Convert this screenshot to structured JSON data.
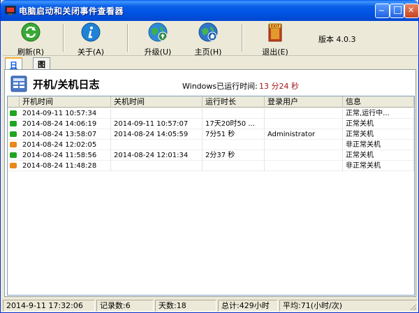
{
  "window": {
    "title": "电脑启动和关闭事件查看器",
    "minimize_glyph": "─",
    "maximize_glyph": "□",
    "close_glyph": "✕"
  },
  "toolbar": {
    "refresh": {
      "label": "刷新(R)",
      "icon": "refresh-icon",
      "color": "#3aa836"
    },
    "about": {
      "label": "关于(A)",
      "icon": "info-icon",
      "color": "#1f82d6"
    },
    "upgrade": {
      "label": "升级(U)",
      "icon": "globe-upgrade-icon",
      "color": "#2f8a44"
    },
    "home": {
      "label": "主页(H)",
      "icon": "globe-home-icon",
      "color": "#2e77c9"
    },
    "exit": {
      "label": "退出(E)",
      "icon": "exit-door-icon",
      "color": "#e0a22b"
    },
    "version": "版本 4.0.3"
  },
  "tabs": [
    {
      "label": "日志",
      "active": true
    },
    {
      "label": "图表",
      "active": false
    }
  ],
  "panel": {
    "title": "开机/关机日志",
    "uptime_label": "Windows已运行时间:",
    "uptime_value": "13 分24 秒"
  },
  "grid": {
    "columns": [
      "开机时间",
      "关机时间",
      "运行时长",
      "登录用户",
      "信息"
    ],
    "rows": [
      {
        "status": "normal",
        "boot": "2014-09-11 10:57:34",
        "shutdown": "",
        "duration": "",
        "user": "",
        "info": "正常,运行中..."
      },
      {
        "status": "normal",
        "boot": "2014-08-24 14:06:19",
        "shutdown": "2014-09-11 10:57:07",
        "duration": "17天20时50 ...",
        "user": "",
        "info": "正常关机"
      },
      {
        "status": "normal",
        "boot": "2014-08-24 13:58:07",
        "shutdown": "2014-08-24 14:05:59",
        "duration": "7分51 秒",
        "user": "Administrator",
        "info": "正常关机"
      },
      {
        "status": "abnormal",
        "boot": "2014-08-24 12:02:05",
        "shutdown": "",
        "duration": "",
        "user": "",
        "info": "非正常关机"
      },
      {
        "status": "normal",
        "boot": "2014-08-24 11:58:56",
        "shutdown": "2014-08-24 12:01:34",
        "duration": "2分37 秒",
        "user": "",
        "info": "正常关机"
      },
      {
        "status": "abnormal",
        "boot": "2014-08-24 11:48:28",
        "shutdown": "",
        "duration": "",
        "user": "",
        "info": "非正常关机"
      }
    ],
    "status_colors": {
      "normal": "#1fa51f",
      "abnormal": "#e8891a"
    }
  },
  "statusbar": {
    "datetime": "2014-9-11 17:32:06",
    "records": "记录数:6",
    "days": "天数:18",
    "total": "总计:429小时",
    "average": "平均:71(小时/次)"
  }
}
